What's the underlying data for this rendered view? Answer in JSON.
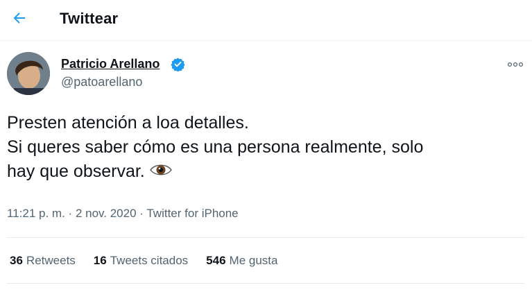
{
  "header": {
    "title": "Twittear"
  },
  "tweet": {
    "author_name": "Patricio Arellano",
    "author_handle": "@patoarellano",
    "text_lines": [
      "Presten atención a loa detalles.",
      "Si queres saber cómo es una persona realmente, solo",
      "hay que observar."
    ],
    "emoji": "eye-emoji",
    "time": "11:21 p. m.",
    "date": "2 nov. 2020",
    "separator": "·",
    "source": "Twitter for iPhone"
  },
  "stats": {
    "retweets_count": "36",
    "retweets_label": "Retweets",
    "quotes_count": "16",
    "quotes_label": "Tweets citados",
    "likes_count": "546",
    "likes_label": "Me gusta"
  },
  "icons": {
    "back": "arrow-left-icon",
    "verified": "verified-badge-icon",
    "more": "more-options-icon"
  },
  "colors": {
    "accent": "#1d9bf0",
    "text": "#0f1419",
    "secondary": "#536471",
    "divider": "#e7ebec"
  }
}
